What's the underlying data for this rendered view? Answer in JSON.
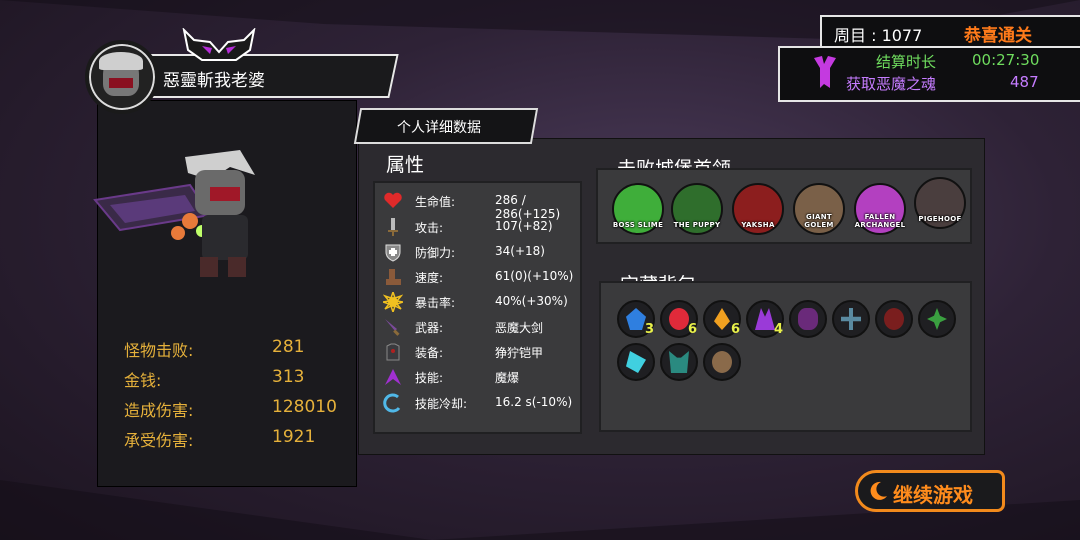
{
  "player": {
    "name": "惡靈斬我老婆"
  },
  "summary": [
    {
      "label": "怪物击败:",
      "value": "281"
    },
    {
      "label": "金钱:",
      "value": "313"
    },
    {
      "label": "造成伤害:",
      "value": "128010"
    },
    {
      "label": "承受伤害:",
      "value": "1921"
    }
  ],
  "run": {
    "loop_label": "周目 : 1077",
    "clear_label": "恭喜通关",
    "duration_label": "结算时长",
    "duration_value": "00:27:30",
    "souls_label": "获取恶魔之魂",
    "souls_value": "487"
  },
  "detail_tab": "个人详细数据",
  "attributes": {
    "title": "属性",
    "rows": [
      {
        "icon": "heart-icon",
        "key": "生命值:",
        "value": "286 / 286(+125)"
      },
      {
        "icon": "sword-icon",
        "key": "攻击:",
        "value": "107(+82)"
      },
      {
        "icon": "shield-icon",
        "key": "防御力:",
        "value": "34(+18)"
      },
      {
        "icon": "boot-icon",
        "key": "速度:",
        "value": "61(0)(+10%)"
      },
      {
        "icon": "burst-icon",
        "key": "暴击率:",
        "value": "40%(+30%)"
      },
      {
        "icon": "weapon-icon",
        "key": "武器:",
        "value": "恶魔大剑"
      },
      {
        "icon": "armor-icon",
        "key": "装备:",
        "value": "狰狞铠甲"
      },
      {
        "icon": "skill-icon",
        "key": "技能:",
        "value": "魔爆"
      },
      {
        "icon": "cooldown-icon",
        "key": "技能冷却:",
        "value": "16.2 s(-10%)"
      }
    ]
  },
  "bosses": {
    "title": "击败城堡首领",
    "items": [
      {
        "label": "BOSS SLIME",
        "color": "#3fae3a"
      },
      {
        "label": "THE PUPPY",
        "color": "#2f6e2c"
      },
      {
        "label": "YAKSHA",
        "color": "#8c1e1e"
      },
      {
        "label": "GIANT GOLEM",
        "color": "#7a6048"
      },
      {
        "label": "FALLEN ARCHANGEL",
        "color": "#b340c0"
      },
      {
        "label": "PIGEHOOF",
        "color": "#4a3e3e"
      }
    ]
  },
  "bag": {
    "title": "宝藏背包",
    "items": [
      {
        "icon": "blue-crystal-icon",
        "color": "#2f7fe0",
        "count": "3"
      },
      {
        "icon": "red-heart-gem-icon",
        "color": "#e02a3a",
        "count": "6"
      },
      {
        "icon": "fire-gem-icon",
        "color": "#f0a020",
        "count": "6"
      },
      {
        "icon": "purple-crystal-icon",
        "color": "#9a3ad8",
        "count": "4"
      },
      {
        "icon": "scorpion-icon",
        "color": "#6a2a7a",
        "count": ""
      },
      {
        "icon": "ankh-icon",
        "color": "#5a8aa0",
        "count": ""
      },
      {
        "icon": "dark-serpent-icon",
        "color": "#7a1e1e",
        "count": ""
      },
      {
        "icon": "flower-icon",
        "color": "#3aa040",
        "count": ""
      },
      {
        "icon": "ice-shard-icon",
        "color": "#40d0e0",
        "count": ""
      },
      {
        "icon": "wolf-icon",
        "color": "#2a8a80",
        "count": ""
      },
      {
        "icon": "seed-pod-icon",
        "color": "#8a6a4a",
        "count": ""
      }
    ]
  },
  "continue_label": "继续游戏"
}
